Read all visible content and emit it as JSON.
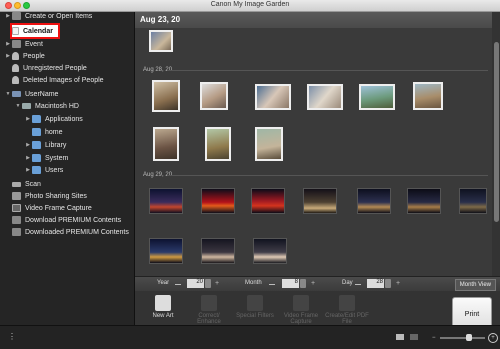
{
  "window": {
    "title": "Canon My Image Garden"
  },
  "sidebar": {
    "items": [
      {
        "label": "Create or Open Items",
        "icon": "create-icon",
        "expand": "collapsed"
      },
      {
        "label": "Calendar",
        "icon": "calendar-icon",
        "selected": true
      },
      {
        "label": "Event",
        "icon": "event-icon",
        "expand": "collapsed"
      },
      {
        "label": "People",
        "icon": "people-icon",
        "expand": "collapsed"
      },
      {
        "label": "Unregistered People",
        "icon": "person-icon"
      },
      {
        "label": "Deleted Images of People",
        "icon": "person-icon"
      },
      {
        "label": "UserName",
        "icon": "monitor-icon",
        "expand": "expanded"
      },
      {
        "label": "Macintosh HD",
        "icon": "hard-drive-icon",
        "expand": "expanded"
      },
      {
        "label": "Applications",
        "icon": "folder-icon",
        "expand": "collapsed"
      },
      {
        "label": "home",
        "icon": "folder-icon"
      },
      {
        "label": "Library",
        "icon": "folder-icon",
        "expand": "collapsed"
      },
      {
        "label": "System",
        "icon": "folder-icon",
        "expand": "collapsed"
      },
      {
        "label": "Users",
        "icon": "folder-icon",
        "expand": "collapsed"
      },
      {
        "label": "Scan",
        "icon": "scan-icon"
      },
      {
        "label": "Photo Sharing Sites",
        "icon": "share-icon"
      },
      {
        "label": "Video Frame Capture",
        "icon": "film-icon"
      },
      {
        "label": "Download PREMIUM Contents",
        "icon": "premium-icon"
      },
      {
        "label": "Downloaded PREMIUM Contents",
        "icon": "premium-icon"
      }
    ]
  },
  "main": {
    "header_date": "Aug 23, 20",
    "sections": [
      {
        "label": "Aug 28, 20"
      },
      {
        "label": "Aug 29, 20"
      }
    ]
  },
  "datebar": {
    "year_label": "Year",
    "year_value": "20",
    "month_label": "Month",
    "month_value": "8",
    "day_label": "Day",
    "day_value": "28",
    "month_view_label": "Month View"
  },
  "toolbar": {
    "new_art": "New Art",
    "correct_enhance": "Correct/ Enhance",
    "special_filters": "Special Filters",
    "video_frame_capture": "Video Frame Capture",
    "create_edit_pdf": "Create/Edit PDF File",
    "print": "Print"
  },
  "colors": {
    "selection_outline": "#ee1111",
    "background": "#3a3a3a",
    "sidebar": "#252525"
  }
}
